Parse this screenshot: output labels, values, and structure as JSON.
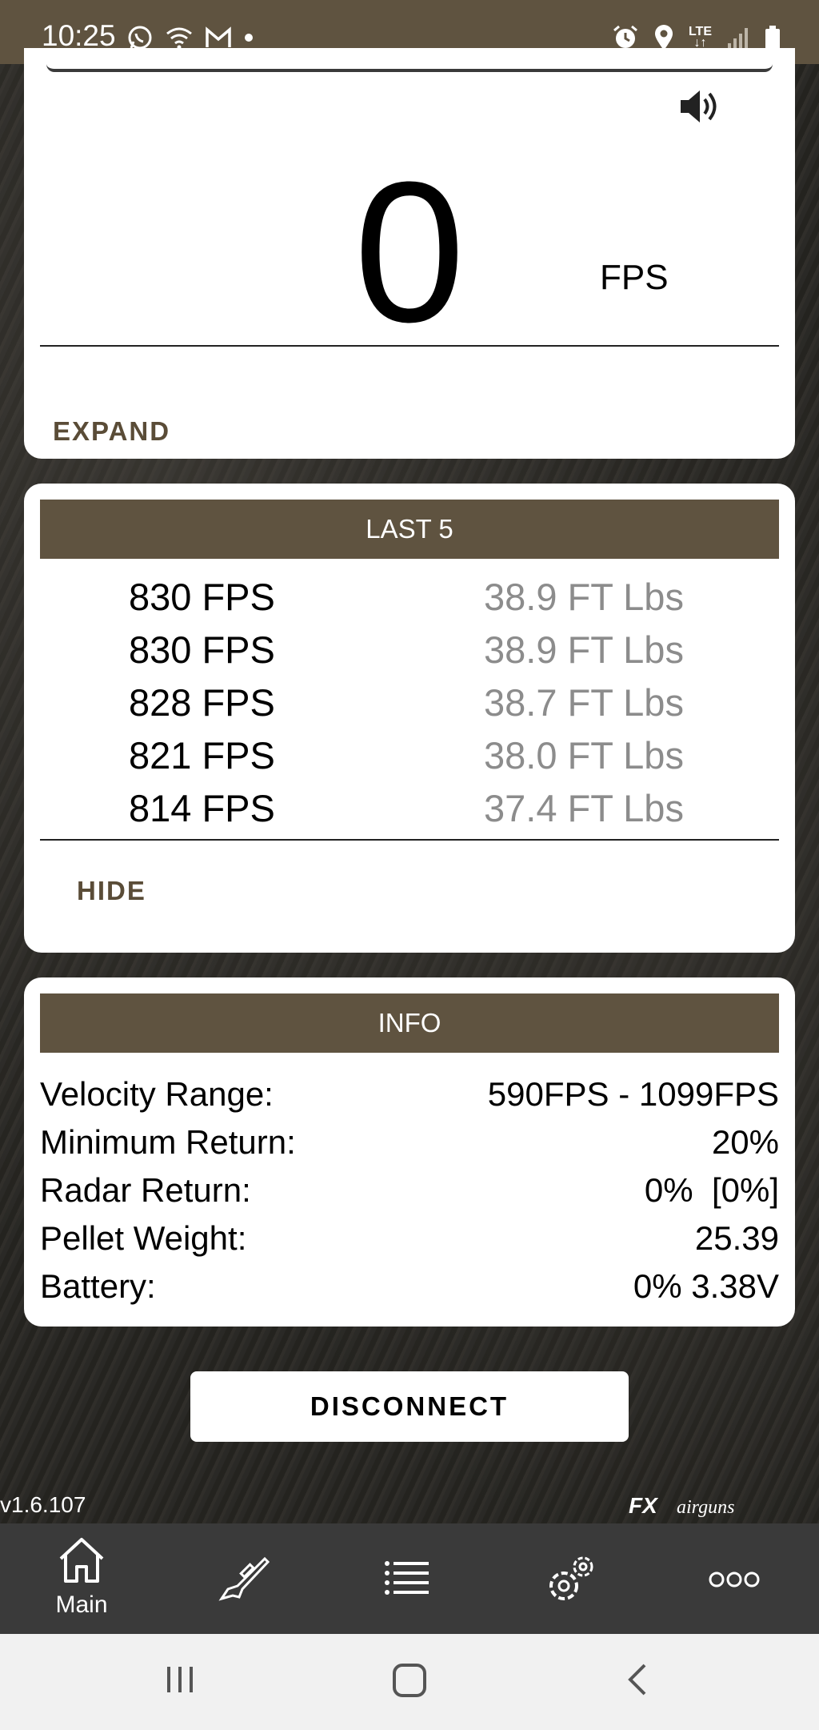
{
  "status_bar": {
    "time": "10:25",
    "left_icons": [
      "whatsapp-icon",
      "wifi-calling-icon",
      "gmail-icon",
      "notification-dot-icon"
    ],
    "right_icons": [
      "alarm-icon",
      "location-icon",
      "lte-icon",
      "signal-icon",
      "battery-icon"
    ],
    "network": "LTE"
  },
  "current_shot": {
    "value": "0",
    "unit": "FPS",
    "expand_label": "EXPAND",
    "sound_icon": "speaker-icon"
  },
  "last5": {
    "title": "LAST 5",
    "rows": [
      {
        "fps": "830 FPS",
        "energy": "38.9 FT Lbs"
      },
      {
        "fps": "830 FPS",
        "energy": "38.9 FT Lbs"
      },
      {
        "fps": "828 FPS",
        "energy": "38.7 FT Lbs"
      },
      {
        "fps": "821 FPS",
        "energy": "38.0 FT Lbs"
      },
      {
        "fps": "814 FPS",
        "energy": "37.4 FT Lbs"
      }
    ],
    "hide_label": "HIDE"
  },
  "info": {
    "title": "INFO",
    "rows": [
      {
        "label": "Velocity Range:",
        "value": "590FPS - 1099FPS"
      },
      {
        "label": "Minimum Return:",
        "value": "20%"
      },
      {
        "label": "Radar Return:",
        "value": "0%  [0%]"
      },
      {
        "label": "Pellet Weight:",
        "value": "25.39"
      },
      {
        "label": "Battery:",
        "value": "0% 3.38V"
      }
    ]
  },
  "disconnect_label": "DISCONNECT",
  "version": "v1.6.107",
  "brand": {
    "main": "FX",
    "sub": "airguns"
  },
  "bottom_nav": [
    {
      "icon": "home-icon",
      "label": "Main"
    },
    {
      "icon": "rifle-icon",
      "label": ""
    },
    {
      "icon": "list-icon",
      "label": ""
    },
    {
      "icon": "settings-icon",
      "label": ""
    },
    {
      "icon": "more-icon",
      "label": ""
    }
  ],
  "colors": {
    "accent": "#5f5340",
    "nav_bg": "#3a3a3a",
    "energy_text": "#8c8c8c"
  }
}
